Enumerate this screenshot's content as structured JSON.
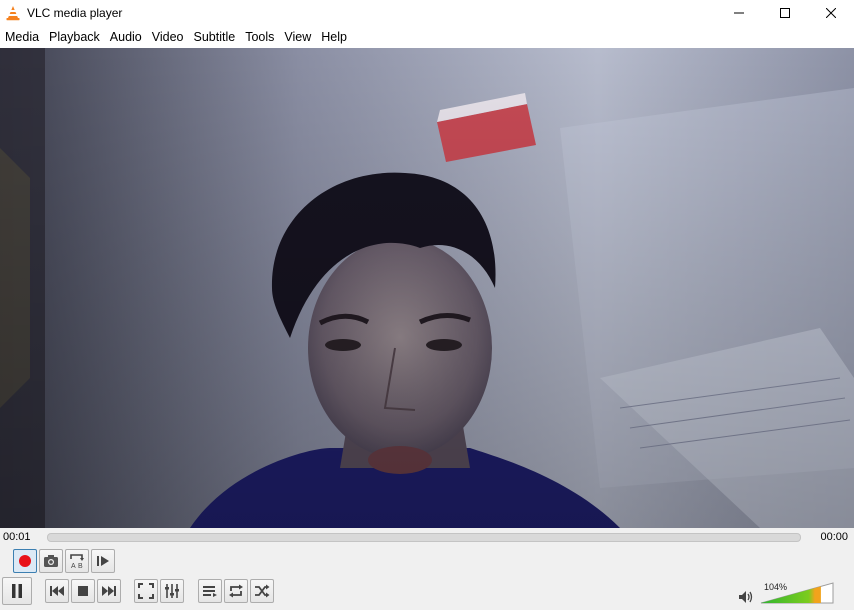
{
  "window": {
    "title": "VLC media player",
    "icon": "vlc-cone-icon",
    "controls": [
      "minimize-icon",
      "maximize-icon",
      "close-icon"
    ]
  },
  "menu": {
    "items": [
      {
        "label": "Media"
      },
      {
        "label": "Playback"
      },
      {
        "label": "Audio"
      },
      {
        "label": "Video"
      },
      {
        "label": "Subtitle"
      },
      {
        "label": "Tools"
      },
      {
        "label": "View"
      },
      {
        "label": "Help"
      }
    ]
  },
  "video": {
    "content": "webcam-frame"
  },
  "seek": {
    "elapsed": "00:01",
    "total": "00:00",
    "position": 0
  },
  "advanced_controls": {
    "record": {
      "icon": "record-icon",
      "active": true
    },
    "snapshot": {
      "icon": "camera-icon"
    },
    "loop_ab": {
      "icon": "loop-ab-icon"
    },
    "frame_step": {
      "icon": "frame-by-frame-icon"
    }
  },
  "main_controls": {
    "play_pause": {
      "icon": "pause-icon"
    },
    "previous": {
      "icon": "previous-icon"
    },
    "stop": {
      "icon": "stop-icon"
    },
    "next": {
      "icon": "next-icon"
    },
    "fullscreen": {
      "icon": "fullscreen-icon"
    },
    "extended_settings": {
      "icon": "equalizer-icon"
    },
    "playlist": {
      "icon": "playlist-icon"
    },
    "loop": {
      "icon": "loop-icon"
    },
    "shuffle": {
      "icon": "shuffle-icon"
    }
  },
  "volume": {
    "label": "104%",
    "level": 1.04,
    "icon": "speaker-icon"
  },
  "colors": {
    "record_red": "#e8121a",
    "volume_green": "#2fb52f",
    "volume_orange": "#f2a31c",
    "vlc_orange": "#f58220"
  }
}
